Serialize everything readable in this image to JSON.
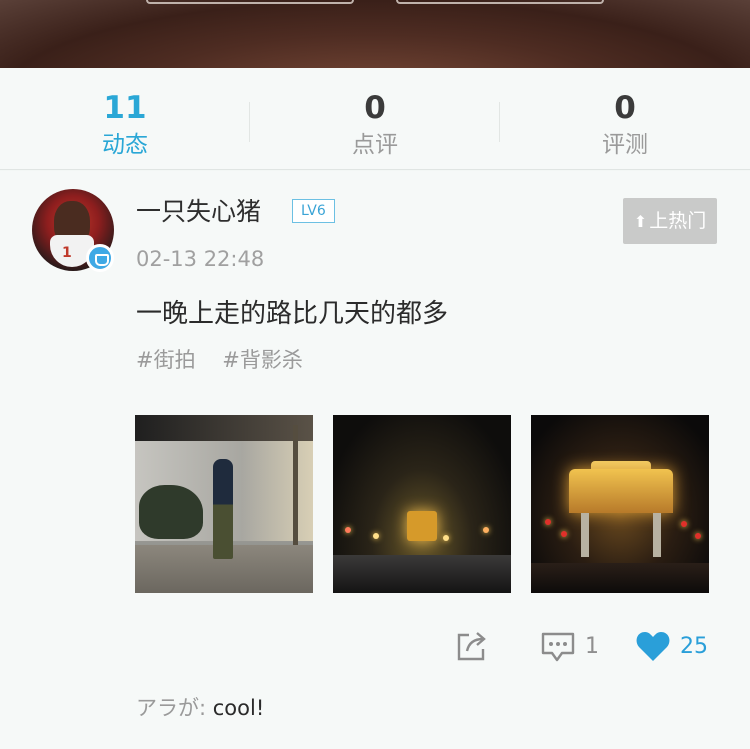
{
  "stats": [
    {
      "count": "11",
      "label": "动态",
      "active": true
    },
    {
      "count": "0",
      "label": "点评",
      "active": false
    },
    {
      "count": "0",
      "label": "评测",
      "active": false
    }
  ],
  "post": {
    "username": "一只失心猪",
    "level": "LV6",
    "timestamp": "02-13 22:48",
    "hot_button": "上热门",
    "content": "一晚上走的路比几天的都多",
    "tags": [
      "#街拍",
      "#背影杀"
    ],
    "photos": [
      "street-night-person-photo",
      "night-street-traffic-photo",
      "illuminated-archway-photo"
    ],
    "comment_count": "1",
    "like_count": "25",
    "reply": {
      "user": "アラが",
      "separator": ": ",
      "text": "cool!"
    }
  },
  "colors": {
    "accent": "#2aa7d6",
    "like": "#2a9fd9",
    "hot_button_bg": "#c9cac9"
  },
  "icons": {
    "share": "share-icon",
    "comment": "comment-icon",
    "like": "heart-icon",
    "verified": "verified-badge-icon"
  }
}
